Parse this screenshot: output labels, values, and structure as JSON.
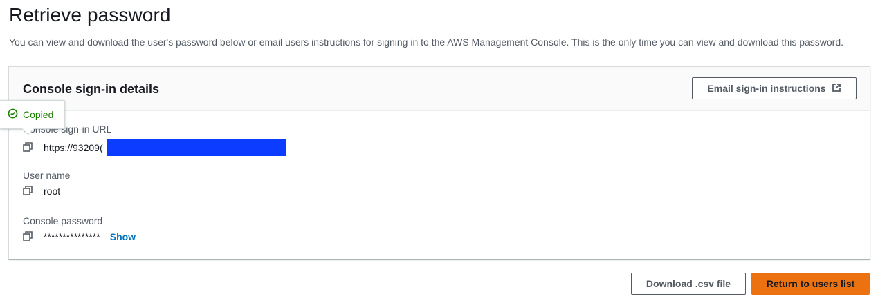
{
  "page": {
    "title": "Retrieve password",
    "description": "You can view and download the user's password below or email users instructions for signing in to the AWS Management Console. This is the only time you can view and download this password."
  },
  "panel": {
    "title": "Console sign-in details",
    "email_button_label": "Email sign-in instructions",
    "email_button_icon": "external-link-icon",
    "fields": {
      "url": {
        "label": "Console sign-in URL",
        "value": "https://93209("
      },
      "username": {
        "label": "User name",
        "value": "root"
      },
      "password": {
        "label": "Console password",
        "value": "***************",
        "show_label": "Show"
      }
    }
  },
  "tooltip": {
    "text": "Copied",
    "icon": "check-circle-icon",
    "color": "#1d8102"
  },
  "footer": {
    "download_label": "Download .csv file",
    "return_label": "Return to users list"
  },
  "colors": {
    "primary": "#ec7211",
    "link": "#0073bb",
    "redaction": "#0b3cff"
  }
}
